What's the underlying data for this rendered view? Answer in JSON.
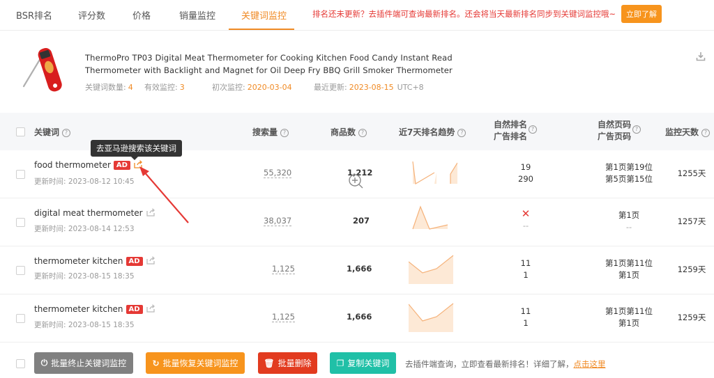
{
  "tabs": [
    {
      "label": "BSR排名"
    },
    {
      "label": "评分数"
    },
    {
      "label": "价格"
    },
    {
      "label": "销量监控"
    },
    {
      "label": "关键词监控"
    }
  ],
  "notice": {
    "text": "排名还未更新？去插件端可查询最新排名。还会将当天最新排名同步到关键词监控哦~",
    "button": "立即了解"
  },
  "product": {
    "title_line1": "ThermoPro TP03 Digital Meat Thermometer for Cooking Kitchen Food Candy Instant Read",
    "title_line2": "Thermometer with Backlight and Magnet for Oil Deep Fry BBQ Grill Smoker Thermometer",
    "meta": {
      "kw_count_label": "关键词数量:",
      "kw_count": "4",
      "valid_label": "有效监控:",
      "valid": "3",
      "first_label": "初次监控:",
      "first": "2020-03-04",
      "last_label": "最近更新:",
      "last": "2023-08-15",
      "tz": "UTC+8"
    }
  },
  "table": {
    "headers": {
      "keyword": "关键词",
      "search_volume": "搜索量",
      "products": "商品数",
      "trend": "近7天排名趋势",
      "natural_rank": "自然排名",
      "ad_rank": "广告排名",
      "natural_page": "自然页码",
      "ad_page": "广告页码",
      "days": "监控天数"
    },
    "rows": [
      {
        "keyword": "food thermometer",
        "ad": "AD",
        "updated": "更新时间: 2023-08-12 10:45",
        "volume": "55,320",
        "products": "1,212",
        "rank_natural": "19",
        "rank_ad": "290",
        "page_natural": "第1页第19位",
        "page_ad": "第5页第15位",
        "days": "1255天"
      },
      {
        "keyword": "digital meat thermometer",
        "ad": "",
        "updated": "更新时间: 2023-08-14 12:53",
        "volume": "38,037",
        "products": "207",
        "rank_natural": "✕",
        "rank_ad": "--",
        "page_natural": "第1页",
        "page_ad": "--",
        "days": "1257天"
      },
      {
        "keyword": "thermometer kitchen",
        "ad": "AD",
        "updated": "更新时间: 2023-08-15 18:35",
        "volume": "1,125",
        "products": "1,666",
        "rank_natural": "11",
        "rank_ad": "1",
        "page_natural": "第1页第11位",
        "page_ad": "第1页",
        "days": "1259天"
      },
      {
        "keyword": "thermometer kitchen",
        "ad": "AD",
        "updated": "更新时间: 2023-08-15 18:35",
        "volume": "1,125",
        "products": "1,666",
        "rank_natural": "11",
        "rank_ad": "1",
        "page_natural": "第1页第11位",
        "page_ad": "第1页",
        "days": "1259天"
      }
    ]
  },
  "tooltip": "去亚马逊搜索该关键词",
  "footer": {
    "stop": "批量终止关键词监控",
    "resume": "批量恢复关键词监控",
    "delete": "批量删除",
    "copy": "复制关键词",
    "note": "去插件端查询，立即查看最新排名！详细了解，",
    "link": "点击这里"
  },
  "colors": {
    "accent": "#f08a24",
    "red": "#e53935",
    "stop": "#808080",
    "resume": "#f7941d",
    "delete": "#e23b1f",
    "copy": "#20c0a7"
  }
}
